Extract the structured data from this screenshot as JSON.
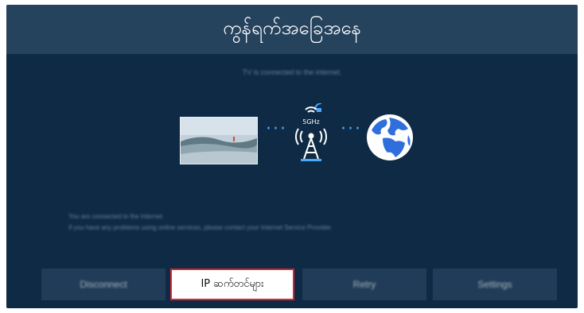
{
  "header": {
    "title": "ကွန်ရက်အခြေအနေ"
  },
  "status": {
    "connected_message": "TV is connected to the internet."
  },
  "diagram": {
    "tv_label": "",
    "router_label": "",
    "frequency_label": "",
    "wifi_band": "5GHz",
    "accent": "#4aa8ff"
  },
  "info": {
    "line1": "You are connected to the Internet.",
    "line2": "If you have any problems using online services, please contact your Internet Service Provider."
  },
  "buttons": [
    {
      "label": "Disconnect",
      "focused": false
    },
    {
      "label": "IP ဆက်တင်များ",
      "focused": true
    },
    {
      "label": "Retry",
      "focused": false
    },
    {
      "label": "Settings",
      "focused": false
    }
  ],
  "colors": {
    "background": "#0f2a45",
    "title_bar": "#26435e",
    "button": "#203c58",
    "focus_border": "#d8262e"
  }
}
